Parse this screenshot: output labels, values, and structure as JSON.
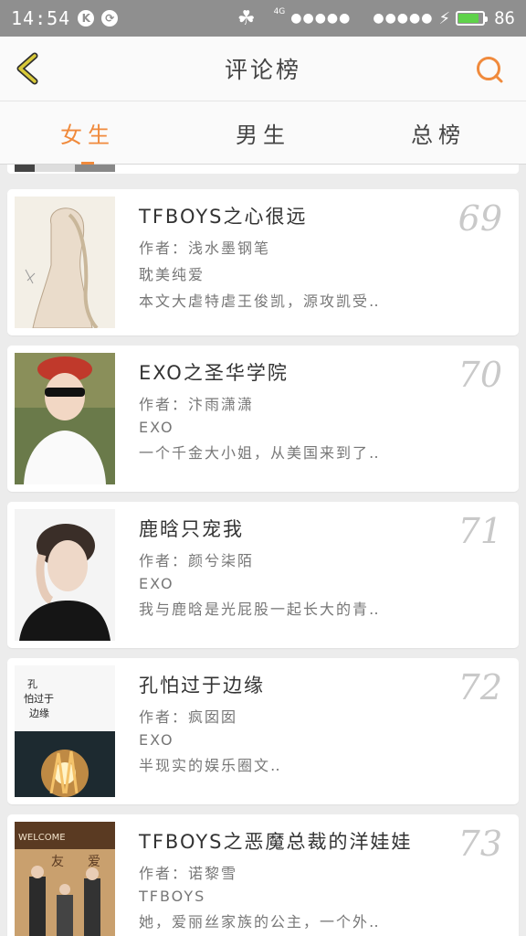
{
  "status_bar": {
    "time": "14:54",
    "icon_k": "K",
    "network": "4G",
    "signal_dots_1": "●●●●●",
    "signal_dots_2": "●●●●●",
    "battery_level": 86,
    "battery_percent": "86",
    "battery_color": "#5fd24a"
  },
  "header": {
    "title": "评论榜",
    "accent_color": "#f08a3c",
    "back_icon_color": "#d8c93a"
  },
  "tabs": [
    {
      "label": "女生",
      "active": true
    },
    {
      "label": "男生",
      "active": false
    },
    {
      "label": "总榜",
      "active": false
    }
  ],
  "books": [
    {
      "rank": "69",
      "title": "TFBOYS之心很远",
      "author": "作者：浅水墨钢笔",
      "category": "耽美纯爱",
      "summary": "本文大虐特虐王俊凯，源攻凯受‥"
    },
    {
      "rank": "70",
      "title": "EXO之圣华学院",
      "author": "作者：汴雨潇潇",
      "category": "EXO",
      "summary": "一个千金大小姐，从美国来到了‥"
    },
    {
      "rank": "71",
      "title": "鹿晗只宠我",
      "author": "作者：颜兮柒陌",
      "category": "EXO",
      "summary": "我与鹿晗是光屁股一起长大的青‥"
    },
    {
      "rank": "72",
      "title": "孔怕过于边缘",
      "author": "作者：疯囡囡",
      "category": "EXO",
      "summary": "半现实的娱乐圈文‥",
      "cover_text_1": "孔",
      "cover_text_2": "怕过于",
      "cover_text_3": "边缘"
    },
    {
      "rank": "73",
      "title": "TFBOYS之恶魔总裁的洋娃娃",
      "author": "作者：诺黎雪",
      "category": "TFBOYS",
      "summary": "她，爱丽丝家族的公主，一个外‥",
      "cover_text_1": "WELCOME",
      "cover_text_2": "友",
      "cover_text_3": "爱"
    }
  ]
}
